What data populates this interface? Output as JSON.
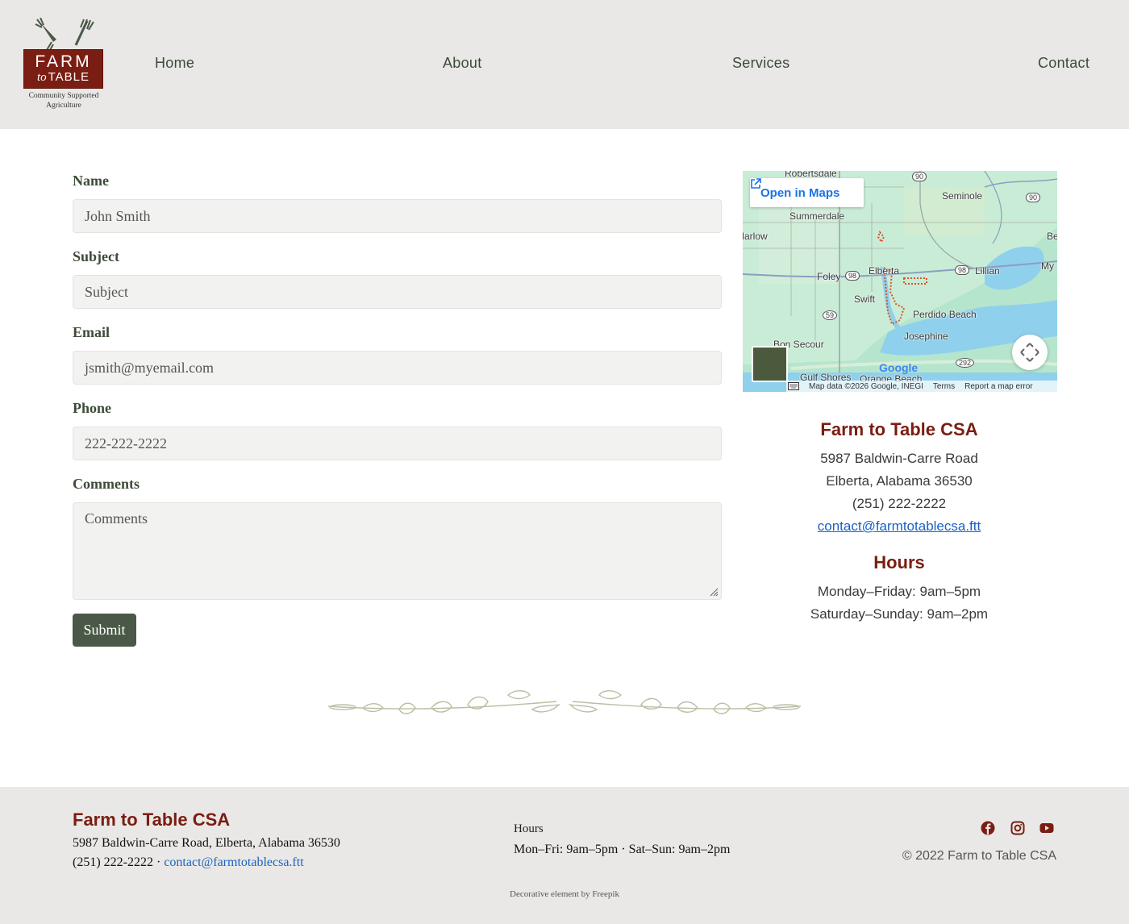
{
  "brand": {
    "logo_farm": "FARM",
    "logo_to": "to",
    "logo_table": "TABLE",
    "logo_tagline_1": "Community Supported",
    "logo_tagline_2": "Agriculture",
    "color_primary": "#7a1d12",
    "color_green": "#4a5947"
  },
  "nav": {
    "home": "Home",
    "about": "About",
    "services": "Services",
    "contact": "Contact"
  },
  "form": {
    "name_label": "Name",
    "name_value": "John Smith",
    "subject_label": "Subject",
    "subject_placeholder": "Subject",
    "email_label": "Email",
    "email_value": "jsmith@myemail.com",
    "phone_label": "Phone",
    "phone_value": "222-222-2222",
    "comments_label": "Comments",
    "comments_placeholder": "Comments",
    "submit_label": "Submit"
  },
  "map": {
    "open_in_maps": "Open in Maps",
    "labels": {
      "robertsdale": "Robertsdale",
      "seminole": "Seminole",
      "summerdale": "Summerdale",
      "marlow": "Marlow",
      "be": "Be",
      "my": "My",
      "foley": "Foley",
      "elberta": "Elberta",
      "lillian": "Lillian",
      "swift": "Swift",
      "perdido_beach": "Perdido Beach",
      "josephine": "Josephine",
      "bon_secour": "Bon Secour",
      "gulf_shores": "Gulf Shores",
      "orange_beach": "Orange Beach"
    },
    "route_badges": {
      "r90a": "90",
      "r90b": "90",
      "r98a": "98",
      "r98b": "98",
      "r59": "59",
      "r292": "292"
    },
    "google_logo": "Google",
    "map_data": "Map data ©2026 Google, INEGI",
    "terms": "Terms",
    "report": "Report a map error"
  },
  "contact_info": {
    "title": "Farm to Table CSA",
    "street": "5987 Baldwin-Carre Road",
    "city": "Elberta, Alabama 36530",
    "phone": "(251) 222-2222",
    "email": "contact@farmtotablecsa.ftt",
    "hours_title": "Hours",
    "weekday_hours": "Monday–Friday: 9am–5pm",
    "weekend_hours": "Saturday–Sunday: 9am–2pm"
  },
  "footer": {
    "title": "Farm to Table CSA",
    "address": "5987 Baldwin-Carre Road, Elberta, Alabama 36530",
    "phone": "(251) 222-2222 ·",
    "email": "contact@farmtotablecsa.ftt",
    "hours_heading": "Hours",
    "hours": "Mon–Fri: 9am–5pm · Sat–Sun: 9am–2pm",
    "copyright": "© 2022 Farm to Table CSA",
    "credit": "Decorative element by Freepik"
  }
}
